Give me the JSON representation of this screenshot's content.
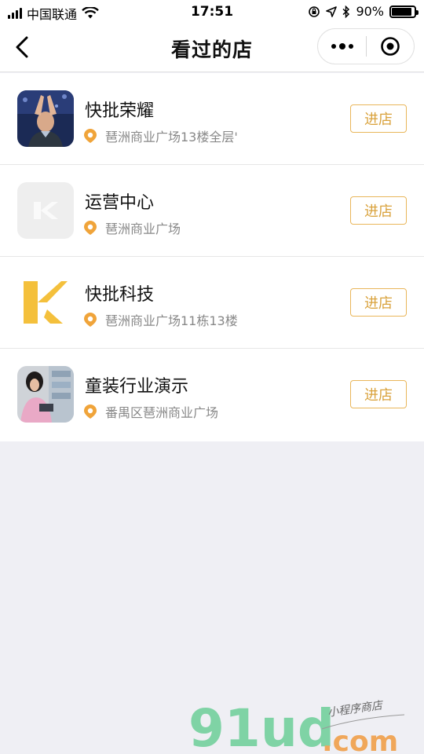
{
  "status_bar": {
    "carrier": "中国联通",
    "time": "17:51",
    "battery_text": "90%",
    "battery_level": 0.9
  },
  "nav": {
    "title": "看过的店"
  },
  "shops": [
    {
      "name": "快批荣耀",
      "address": "琶洲商业广场13楼全层'",
      "button": "进店"
    },
    {
      "name": "运营中心",
      "address": "琶洲商业广场",
      "button": "进店"
    },
    {
      "name": "快批科技",
      "address": "琶洲商业广场11栋13楼",
      "button": "进店"
    },
    {
      "name": "童装行业演示",
      "address": "番禺区琶洲商业广场",
      "button": "进店"
    }
  ],
  "watermark": {
    "main": "91ud",
    "domain": ".com",
    "tagline": "小程序商店"
  },
  "colors": {
    "accent": "#e9b65a",
    "pin": "#f0a43a",
    "logo_yellow": "#f4c03c",
    "watermark_green": "#7fd3a5",
    "watermark_orange": "#f0a75a"
  },
  "icons": {
    "back": "chevron-left-icon",
    "more": "more-dots-icon",
    "close": "target-circle-icon",
    "location": "location-pin-icon",
    "wifi": "wifi-icon",
    "battery": "battery-icon"
  }
}
